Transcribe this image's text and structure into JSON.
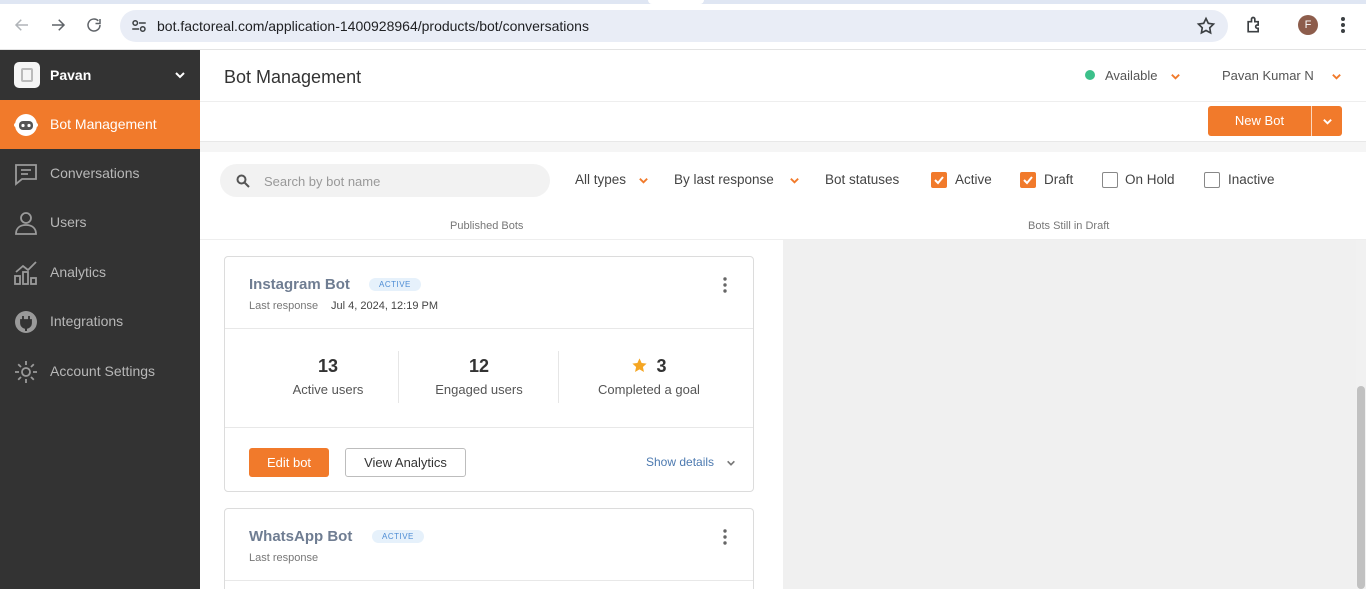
{
  "browser": {
    "url": "bot.factoreal.com/application-1400928964/products/bot/conversations",
    "profile_initial": "F"
  },
  "sidebar": {
    "workspace_name": "Pavan",
    "items": [
      {
        "label": "Bot Management",
        "icon": "bot-icon",
        "active": true
      },
      {
        "label": "Conversations",
        "icon": "chat-icon"
      },
      {
        "label": "Users",
        "icon": "user-icon"
      },
      {
        "label": "Analytics",
        "icon": "analytics-icon"
      },
      {
        "label": "Integrations",
        "icon": "plug-icon"
      },
      {
        "label": "Account Settings",
        "icon": "gear-icon"
      }
    ]
  },
  "header": {
    "title": "Bot Management",
    "availability": "Available",
    "user_name": "Pavan Kumar N"
  },
  "toolbar": {
    "new_bot_label": "New Bot"
  },
  "filters": {
    "search_placeholder": "Search by bot name",
    "type_filter": "All types",
    "sort_filter": "By last response",
    "statuses_label": "Bot statuses",
    "statuses": [
      {
        "label": "Active",
        "checked": true
      },
      {
        "label": "Draft",
        "checked": true
      },
      {
        "label": "On Hold",
        "checked": false
      },
      {
        "label": "Inactive",
        "checked": false
      }
    ]
  },
  "columns": {
    "published": "Published Bots",
    "draft": "Bots Still in Draft"
  },
  "bots": [
    {
      "name": "Instagram Bot",
      "status": "ACTIVE",
      "last_response_label": "Last response",
      "last_response": "Jul 4, 2024, 12:19 PM",
      "active_users": "13",
      "active_users_label": "Active users",
      "engaged_users": "12",
      "engaged_users_label": "Engaged users",
      "completed_goal": "3",
      "completed_goal_label": "Completed a goal",
      "edit_label": "Edit bot",
      "analytics_label": "View Analytics",
      "details_label": "Show details"
    },
    {
      "name": "WhatsApp Bot",
      "status": "ACTIVE",
      "last_response_label": "Last response",
      "last_response": ""
    }
  ],
  "colors": {
    "accent": "#f17a2b",
    "sidebar_bg": "#333333",
    "available": "#3cc08a"
  }
}
